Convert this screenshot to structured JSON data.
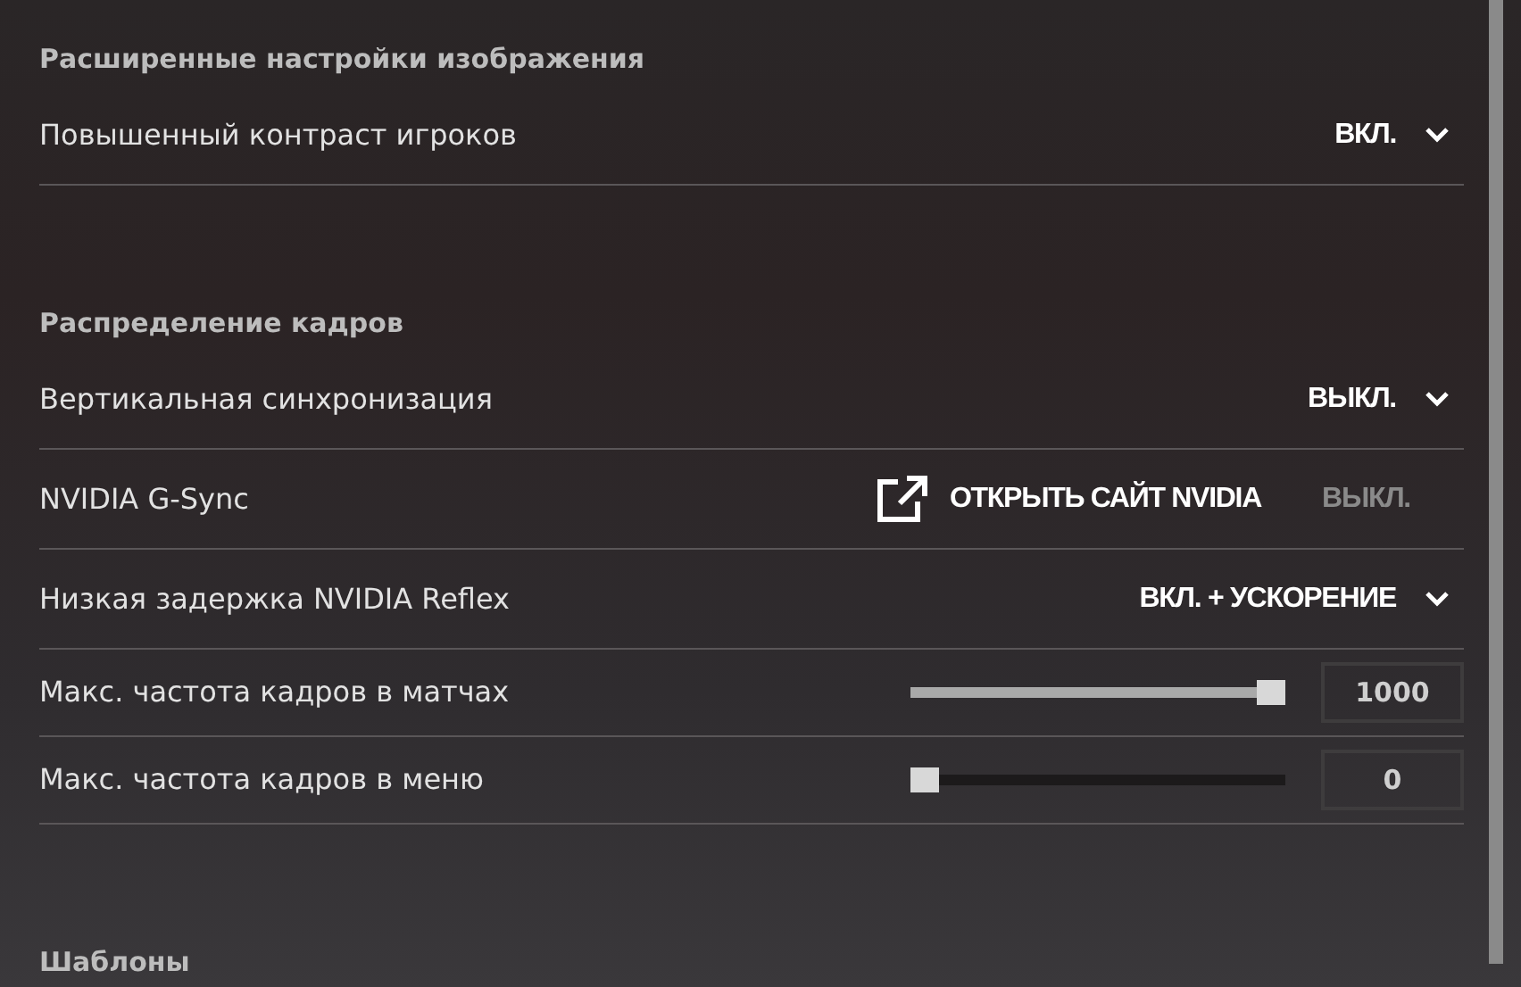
{
  "sections": [
    {
      "title": "Расширенные настройки изображения",
      "rows": [
        {
          "kind": "dropdown",
          "label": "Повышенный контраст игроков",
          "value": "ВКЛ.",
          "disabled": false
        }
      ]
    },
    {
      "title": "Распределение кадров",
      "rows": [
        {
          "kind": "dropdown",
          "label": "Вертикальная синхронизация",
          "value": "ВЫКЛ.",
          "disabled": false
        },
        {
          "kind": "link",
          "label": "NVIDIA G-Sync",
          "link": "ОТКРЫТЬ САЙТ NVIDIA",
          "value": "ВЫКЛ.",
          "disabled": true
        },
        {
          "kind": "dropdown",
          "label": "Низкая задержка NVIDIA Reflex",
          "value": "ВКЛ. + УСКОРЕНИЕ",
          "disabled": false
        },
        {
          "kind": "slider",
          "label": "Макс. частота кадров в матчах",
          "level": 1,
          "value": "1000"
        },
        {
          "kind": "slider",
          "label": "Макс. частота кадров в меню",
          "level": 0,
          "value": "0"
        }
      ]
    },
    {
      "title": "Шаблоны"
    }
  ]
}
